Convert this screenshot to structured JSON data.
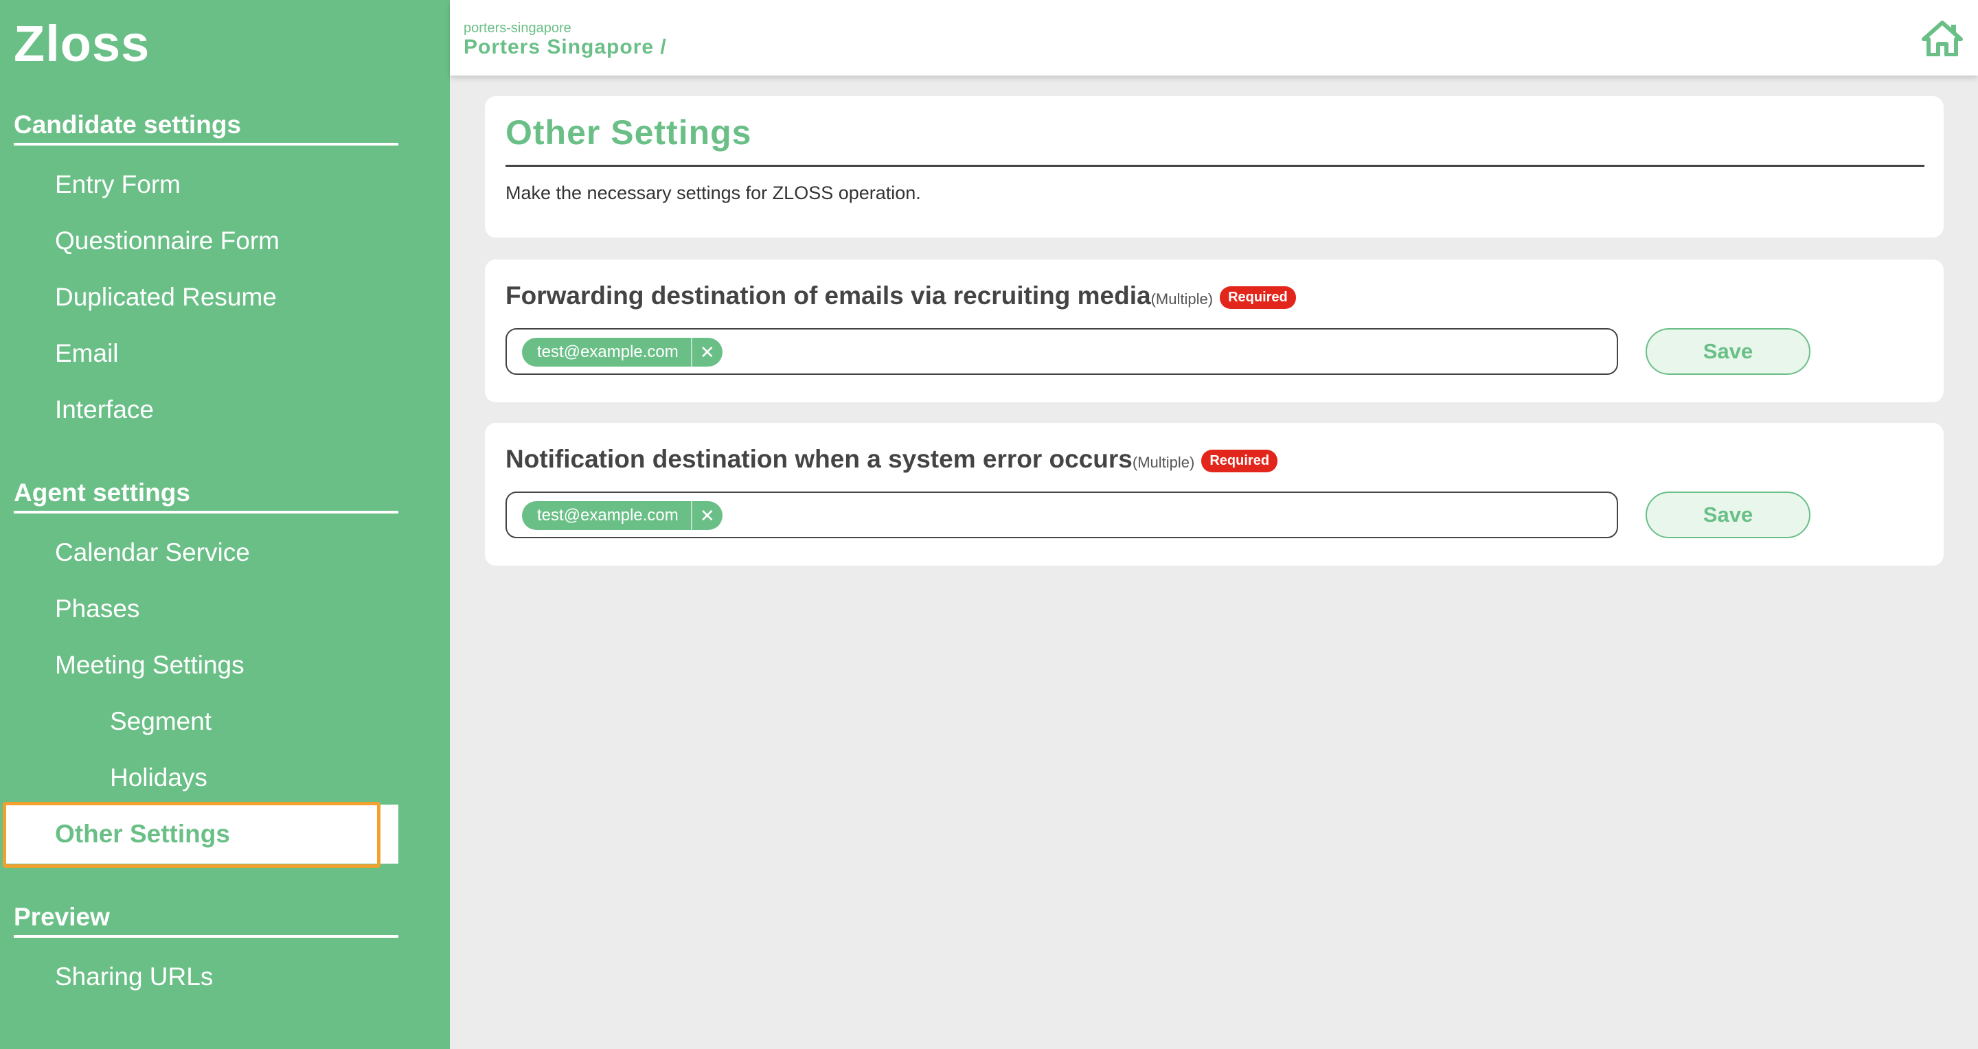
{
  "app": {
    "logo": "Zloss"
  },
  "sidebar": {
    "sections": [
      {
        "title": "Candidate settings",
        "items": [
          "Entry Form",
          "Questionnaire Form",
          "Duplicated Resume",
          "Email",
          "Interface"
        ]
      },
      {
        "title": "Agent settings",
        "items": [
          "Calendar Service",
          "Phases",
          "Meeting Settings"
        ],
        "subitems": [
          "Segment",
          "Holidays"
        ],
        "active": "Other Settings"
      },
      {
        "title": "Preview",
        "items": [
          "Sharing URLs"
        ]
      }
    ]
  },
  "breadcrumb": {
    "slug": "porters-singapore",
    "title": "Porters Singapore /"
  },
  "page": {
    "title": "Other Settings",
    "description": "Make the necessary settings for ZLOSS operation."
  },
  "fields": [
    {
      "label": "Forwarding destination of emails via recruiting media",
      "multiple": "(Multiple)",
      "badge": "Required",
      "chips": [
        "test@example.com"
      ],
      "save_label": "Save"
    },
    {
      "label": "Notification destination when a system error occurs",
      "multiple": "(Multiple)",
      "badge": "Required",
      "chips": [
        "test@example.com"
      ],
      "save_label": "Save"
    }
  ],
  "icons": {
    "home": "home-icon",
    "remove": "close-icon"
  },
  "colors": {
    "accent": "#6abf87",
    "required": "#e3261b",
    "highlight": "#f2a12e"
  }
}
